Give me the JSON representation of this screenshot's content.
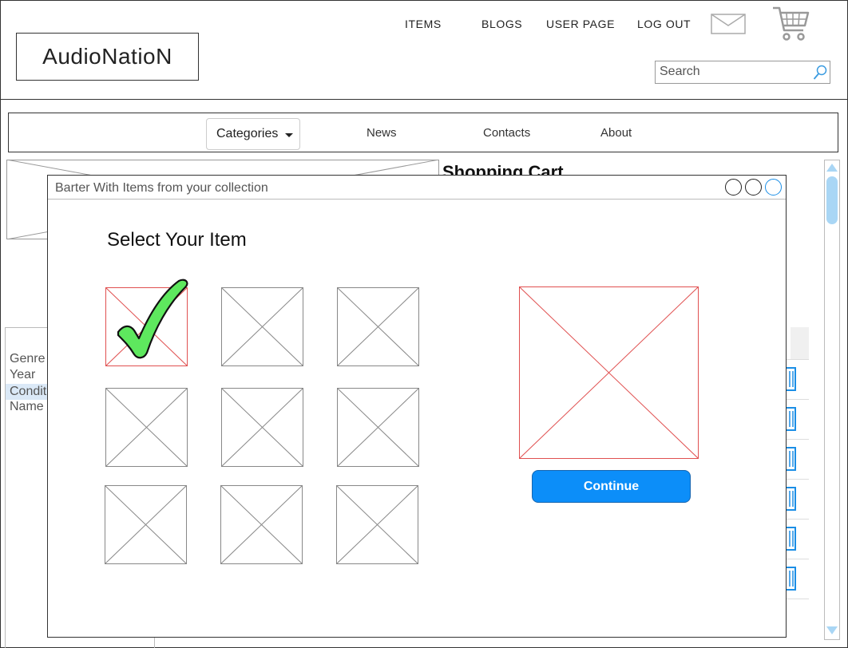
{
  "header": {
    "logo": "AudioNatioN",
    "nav": [
      "ITEMS",
      "BLOGS",
      "USER PAGE",
      "LOG OUT"
    ],
    "search_placeholder": "Search"
  },
  "navbar": {
    "categories_label": "Categories",
    "items": [
      "News",
      "Contacts",
      "About"
    ]
  },
  "background": {
    "cart_title": "Shopping Cart",
    "filters": [
      "Genre",
      "Year",
      "Condit",
      "Name"
    ]
  },
  "modal": {
    "title": "Barter With Items from your collection",
    "heading": "Select Your Item",
    "continue_label": "Continue"
  },
  "colors": {
    "accent": "#0c8ef9",
    "selected_border": "#e05050",
    "checkmark": "#5ee85e"
  }
}
